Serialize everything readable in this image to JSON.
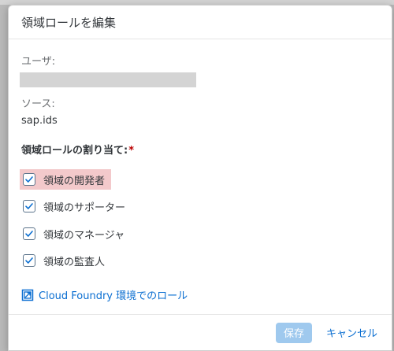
{
  "dialog": {
    "title": "領域ロールを編集",
    "user_label": "ユーザ:",
    "source_label": "ソース:",
    "source_value": "sap.ids",
    "roles_label": "領域ロールの割り当て:",
    "required_mark": "*",
    "roles": [
      {
        "label": "領域の開発者",
        "checked": true
      },
      {
        "label": "領域のサポーター",
        "checked": true
      },
      {
        "label": "領域のマネージャ",
        "checked": true
      },
      {
        "label": "領域の監査人",
        "checked": true
      }
    ],
    "link": {
      "icon": "external-link-icon",
      "label": "Cloud Foundry 環境でのロール"
    },
    "footer": {
      "save_label": "保存",
      "cancel_label": "キャンセル"
    }
  },
  "colors": {
    "accent": "#0a6ed1",
    "save_button_disabled": "#9fc9ee",
    "highlight": "#f3c9cb",
    "required": "#bb0000"
  }
}
